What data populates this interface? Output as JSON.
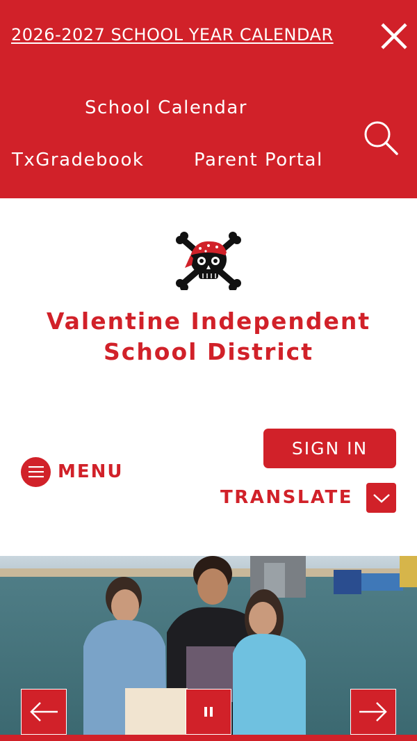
{
  "alert": {
    "link_text": "2026-2027 SCHOOL YEAR CALENDAR"
  },
  "quick_links": {
    "school_calendar": "School Calendar",
    "txgradebook": "TxGradebook",
    "parent_portal": "Parent Portal"
  },
  "district": {
    "name_line1": "Valentine Independent",
    "name_line2": "School District"
  },
  "nav": {
    "menu_label": "MENU",
    "sign_in_label": "SIGN IN",
    "translate_label": "TRANSLATE"
  },
  "colors": {
    "brand_red": "#d12129",
    "white": "#ffffff"
  },
  "icons": {
    "close": "close-icon",
    "search": "search-icon",
    "menu": "hamburger-icon",
    "translate": "chevron-down-icon",
    "prev": "arrow-left-icon",
    "pause": "pause-icon",
    "next": "arrow-right-icon",
    "logo": "pirate-skull-crossbones-logo"
  }
}
